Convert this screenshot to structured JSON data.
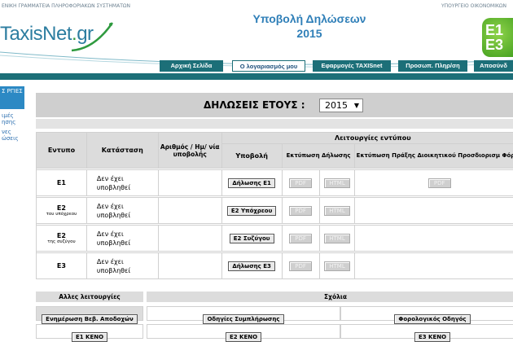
{
  "header": {
    "top_left": "ΕΝΙΚΗ ΓΡΑΜΜΑΤΕΙΑ ΠΛΗΡΟΦΟΡΙΑΚΩΝ ΣΥΣΤΗΜΑΤΩΝ",
    "top_right": "ΥΠΟΥΡΓΕΙΟ ΟΙΚΟΝΟΜΙΚΩΝ",
    "logo_main": "TaxisNet",
    "logo_dot": ".",
    "logo_suffix": "gr",
    "title_line1": "Υποβολή Δηλώσεων",
    "title_line2": "2015",
    "badge": "E1 E3"
  },
  "nav": [
    "Αρχική Σελίδα",
    "Ο λογαριασμός μου",
    "Εφαρμογές TAXISnet",
    "Προσωπ. Πληρ/ση",
    "Αποσύνδ"
  ],
  "sidebar": {
    "head": "Σ ΡΓΙΕΣ",
    "links": [
      "ιμές ησης",
      "νες ώσεις"
    ]
  },
  "main": {
    "year_label": "ΔΗΛΩΣΕΙΣ ΕΤΟΥΣ :",
    "year_value": "2015",
    "headers": {
      "form": "Εντυπο",
      "status": "Κατάσταση",
      "number": "Αριθμός / Ημ/ νία υποβολής",
      "ops": "Λειτουργίες εντύπου",
      "submit": "Υποβολή",
      "print_decl": "Εκτύπωση Δήλωσης",
      "print_act": "Εκτύπωση Πράξης Διοικητικού Προσδιορισμ Φόρου"
    },
    "rows": [
      {
        "form": "E1",
        "sub": "",
        "status": "Δεν έχει υποβληθεί",
        "submit": "Δήλωσης Ε1",
        "pdf": "PDF",
        "html": "HTML",
        "act_pdf": "PDF"
      },
      {
        "form": "E2",
        "sub": "του υπόχρεου",
        "status": "Δεν έχει υποβληθεί",
        "submit": "Ε2 Υπόχρεου",
        "pdf": "PDF",
        "html": "HTML",
        "act_pdf": ""
      },
      {
        "form": "E2",
        "sub": "της συζύγου",
        "status": "Δεν έχει υποβληθεί",
        "submit": "Ε2 Συζύγου",
        "pdf": "PDF",
        "html": "HTML",
        "act_pdf": ""
      },
      {
        "form": "E3",
        "sub": "",
        "status": "Δεν έχει υποβληθεί",
        "submit": "Δήλωσης Ε3",
        "pdf": "PDF",
        "html": "HTML",
        "act_pdf": ""
      }
    ]
  },
  "bottom": {
    "other_title": "Αλλες λειτουργίες",
    "comments_title": "Σχόλια",
    "buttons": {
      "update": "Ενημέρωση Βεβ. Αποδοχών",
      "guide": "Οδηγίες Συμπλήρωσης",
      "tax_guide": "Φορολογικός Οδηγός",
      "e1_blank": "Ε1 ΚΕΝΟ",
      "e2_blank": "Ε2 ΚΕΝΟ",
      "e3_blank": "Ε3 ΚΕΝΟ"
    }
  },
  "colors": {
    "nav": "#1c6f78",
    "title": "#2f7fb8",
    "logo": "#2c7da0",
    "accent_green": "#3a9a1a"
  }
}
